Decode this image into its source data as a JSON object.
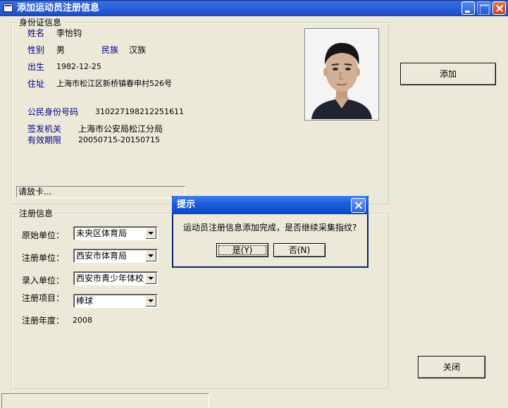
{
  "window": {
    "title": "添加运动员注册信息"
  },
  "id_card": {
    "legend": "身份证信息",
    "name_label": "姓名",
    "name_value": "李怡钧",
    "gender_label": "性别",
    "gender_value": "男",
    "ethnicity_label": "民族",
    "ethnicity_value": "汉族",
    "birth_label": "出生",
    "birth_value": "1982-12-25",
    "address_label": "住址",
    "address_value": "上海市松江区新桥镇春申村526号",
    "idnum_label": "公民身份号码",
    "idnum_value": "310227198212251611",
    "issuer_label": "签发机关",
    "issuer_value": "上海市公安局松江分局",
    "validity_label": "有效期限",
    "validity_value": "20050715-20150715",
    "status_text": "请放卡..."
  },
  "registration": {
    "legend": "注册信息",
    "original_unit_label": "原始单位：",
    "original_unit_value": "未央区体育局",
    "reg_unit_label": "注册单位：",
    "reg_unit_value": "西安市体育局",
    "entry_unit_label": "录入单位：",
    "entry_unit_value": "西安市青少年体校",
    "project_label": "注册项目：",
    "project_value": "棒球",
    "year_label": "注册年度：",
    "year_value": "2008"
  },
  "buttons": {
    "add": "添加",
    "close": "关闭"
  },
  "dialog": {
    "title": "提示",
    "message": "运动员注册信息添加完成，是否继续采集指纹?",
    "yes": "是(Y)",
    "no": "否(N)"
  },
  "icons": [
    "app-icon",
    "minimize-icon",
    "maximize-icon",
    "close-icon",
    "dropdown-arrow-icon"
  ]
}
